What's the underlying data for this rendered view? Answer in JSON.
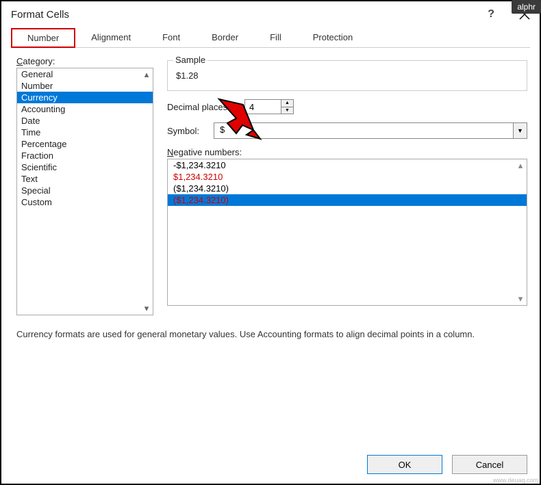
{
  "badge": "alphr",
  "titlebar": {
    "title": "Format Cells",
    "help": "?",
    "close": "✕"
  },
  "tabs": [
    "Number",
    "Alignment",
    "Font",
    "Border",
    "Fill",
    "Protection"
  ],
  "active_tab_index": 0,
  "category": {
    "label": "Category:",
    "items": [
      "General",
      "Number",
      "Currency",
      "Accounting",
      "Date",
      "Time",
      "Percentage",
      "Fraction",
      "Scientific",
      "Text",
      "Special",
      "Custom"
    ],
    "selected_index": 2
  },
  "sample": {
    "legend": "Sample",
    "value": "$1.28"
  },
  "decimal": {
    "label": "Decimal places:",
    "value": "4"
  },
  "symbol": {
    "label": "Symbol:",
    "value": "$"
  },
  "negative": {
    "label": "Negative numbers:",
    "items": [
      {
        "text": "-$1,234.3210",
        "red": false
      },
      {
        "text": "$1,234.3210",
        "red": true
      },
      {
        "text": "($1,234.3210)",
        "red": false
      },
      {
        "text": "($1,234.3210)",
        "red": true
      }
    ],
    "selected_index": 3
  },
  "description": "Currency formats are used for general monetary values.  Use Accounting formats to align decimal points in a column.",
  "buttons": {
    "ok": "OK",
    "cancel": "Cancel"
  },
  "watermark": "www.deuaq.com"
}
